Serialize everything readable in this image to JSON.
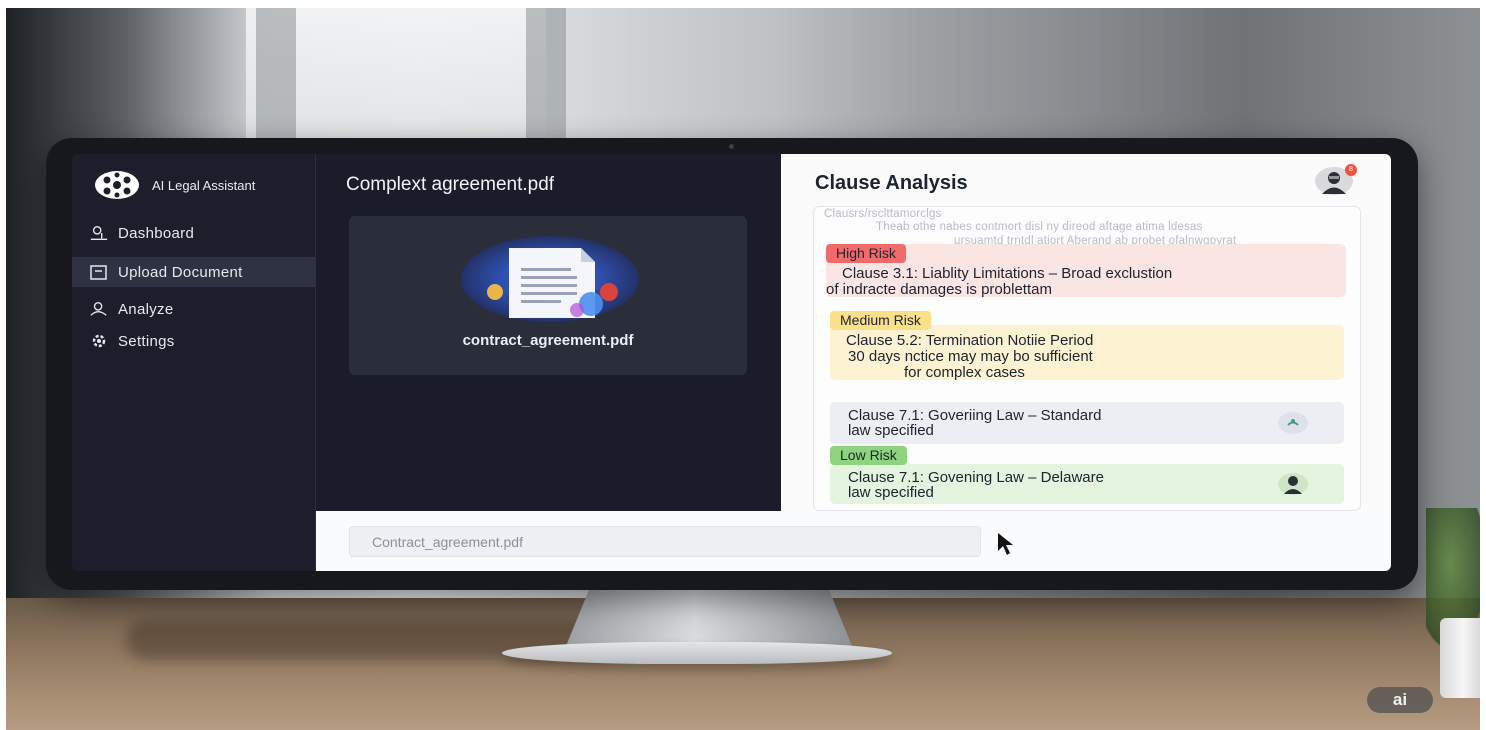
{
  "app": {
    "brand_name": "AI Legal Assistant"
  },
  "sidebar": {
    "items": [
      {
        "label": "Dashboard",
        "icon": "user-icon"
      },
      {
        "label": "Upload Document",
        "icon": "upload-icon",
        "active": true
      },
      {
        "label": "Analyze",
        "icon": "user-icon"
      },
      {
        "label": "Settings",
        "icon": "gear-icon"
      }
    ]
  },
  "document": {
    "title": "Complext agreement.pdf",
    "file_name": "contract_agreement.pdf"
  },
  "analysis": {
    "title": "Clause Analysis",
    "notification_count": "8",
    "ghost_header": "Clausrs/rsclttamorclgs",
    "ghost_lines": [
      "Theab othe nabes contmort disl ny direod aftage atima ldesas",
      "ursuamtd trntdl atiort Aberand ab probet ofalnwgpyrat"
    ],
    "high": {
      "tag": "High Risk",
      "line1": "Clause 3.1: Liablity Limitations – Broad exclustion",
      "line2": "of indracte damages is problettam",
      "color": "#f26b6b"
    },
    "medium": {
      "tag": "Medium Risk",
      "line1": "Clause 5.2: Termination Notiie Period",
      "line2": "30 days nctice may may bo sufficient",
      "line3": "for complex cases",
      "color": "#fbe08a"
    },
    "neutral": {
      "line1": "Clause 7.1: Goveriing Law – Standard",
      "line2": "law specified"
    },
    "low": {
      "tag": "Low Risk",
      "line1": "Clause 7.1: Govening Law – Delaware",
      "line2": "law specified",
      "color": "#8ed47e"
    }
  },
  "bottom": {
    "file_field_value": "Contract_agreement.pdf"
  },
  "watermark": "ai"
}
